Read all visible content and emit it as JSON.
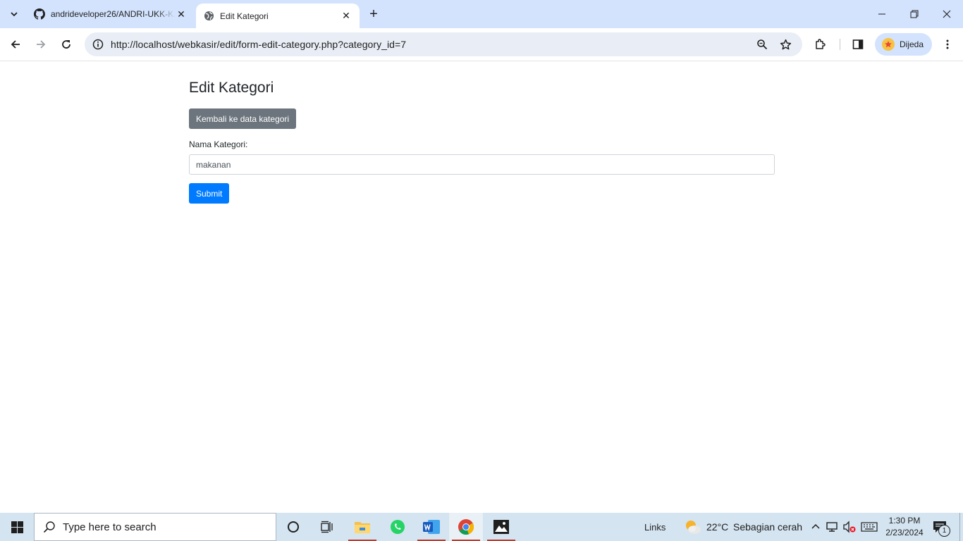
{
  "browser": {
    "tabs": [
      {
        "title": "andrideveloper26/ANDRI-UKK-KASIR",
        "favicon": "github-icon",
        "active": false
      },
      {
        "title": "Edit Kategori",
        "favicon": "globe-icon",
        "active": true
      }
    ],
    "new_tab_label": "+",
    "address_bar": {
      "url": "http://localhost/webkasir/edit/form-edit-category.php?category_id=7"
    },
    "profile": {
      "name": "Dijeda"
    }
  },
  "page": {
    "title": "Edit Kategori",
    "back_button_label": "Kembali ke data kategori",
    "form": {
      "category_label": "Nama Kategori:",
      "category_value": "makanan",
      "submit_label": "Submit"
    }
  },
  "taskbar": {
    "search_placeholder": "Type here to search",
    "links_label": "Links",
    "weather": {
      "temperature": "22°C",
      "condition": "Sebagian cerah"
    },
    "clock": {
      "time": "1:30 PM",
      "date": "2/23/2024"
    },
    "notification_count": "1"
  },
  "colors": {
    "tabstrip_bg": "#d3e3fd",
    "back_button_bg": "#6c757d",
    "submit_button_bg": "#007bff",
    "taskbar_bg": "#d4e4f0"
  }
}
